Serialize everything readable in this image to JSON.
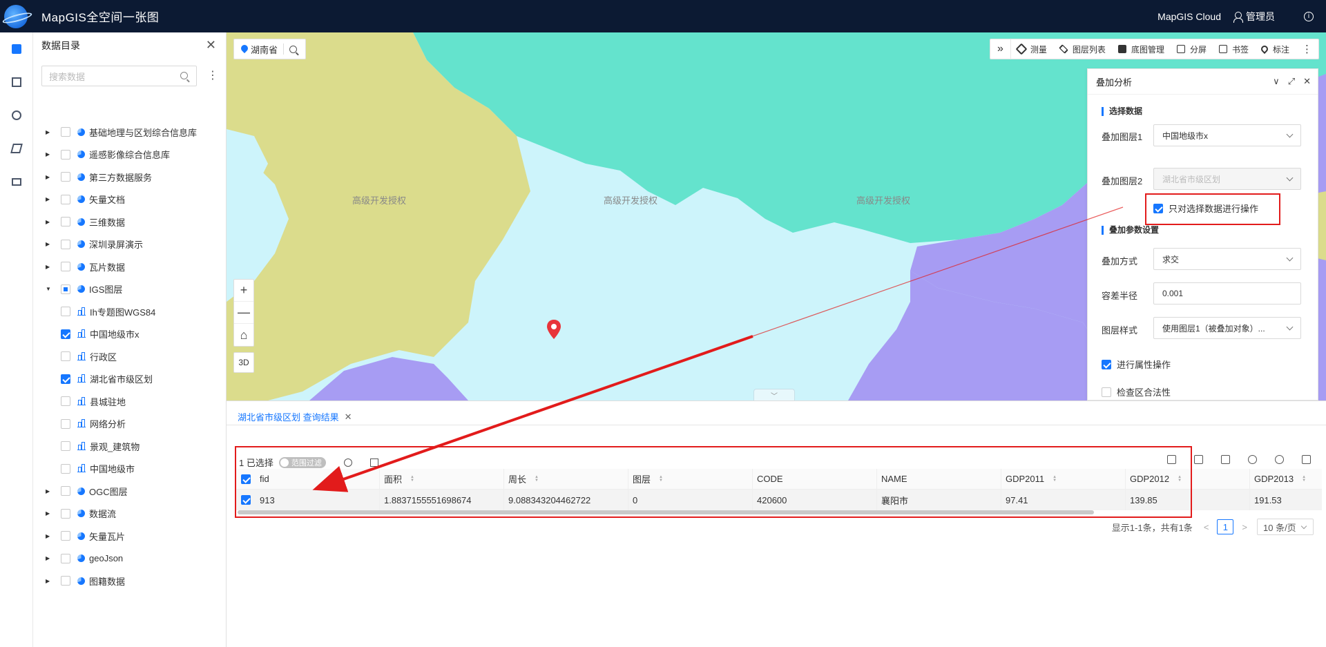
{
  "header": {
    "app_title": "MapGIS全空间一张图",
    "cloud": "MapGIS Cloud",
    "user": "管理员",
    "info": "i"
  },
  "catalog": {
    "title": "数据目录",
    "close": "✕",
    "search_placeholder": "搜索数据",
    "items": [
      {
        "label": "基础地理与区划综合信息库"
      },
      {
        "label": "遥感影像综合信息库"
      },
      {
        "label": "第三方数据服务"
      },
      {
        "label": "矢量文档"
      },
      {
        "label": "三维数据"
      },
      {
        "label": "深圳录屏演示"
      },
      {
        "label": "瓦片数据"
      },
      {
        "label": "IGS图层"
      },
      {
        "label": "Ih专题图WGS84"
      },
      {
        "label": "中国地级市x"
      },
      {
        "label": "行政区"
      },
      {
        "label": "湖北省市级区划"
      },
      {
        "label": "县城驻地"
      },
      {
        "label": "网络分析"
      },
      {
        "label": "景观_建筑物"
      },
      {
        "label": "中国地级市"
      },
      {
        "label": "OGC图层"
      },
      {
        "label": "数据流"
      },
      {
        "label": "矢量瓦片"
      },
      {
        "label": "geoJson"
      },
      {
        "label": "图籍数据"
      }
    ]
  },
  "map": {
    "location": "湖南省",
    "watermarks": [
      "高级开发授权",
      "高级开发授权",
      "高级开发授权"
    ],
    "zoom_in": "+",
    "zoom_out": "—",
    "home": "⌂",
    "mode_3d": "3D",
    "collapse": "﹀",
    "toolbar": {
      "expand": "»",
      "measure": "测量",
      "layers": "图层列表",
      "basemap": "底图管理",
      "split": "分屏",
      "bookmark": "书签",
      "mark": "标注"
    },
    "colors": {
      "light_blue": "#cdf4fb",
      "teal": "#64e3cd",
      "khaki": "#dbdc8c",
      "purple": "#a79cf3",
      "marker": "#e8343a"
    }
  },
  "overlay": {
    "title": "叠加分析",
    "section_data": "选择数据",
    "layer1_label": "叠加图层1",
    "layer1_value": "中国地级市x",
    "layer2_label": "叠加图层2",
    "layer2_value": "湖北省市级区划",
    "only_selected": "只对选择数据进行操作",
    "section_params": "叠加参数设置",
    "method_label": "叠加方式",
    "method_value": "求交",
    "tolerance_label": "容差半径",
    "tolerance_value": "0.001",
    "style_label": "图层样式",
    "style_value": "使用图层1（被叠加对象）...",
    "attr_op": "进行属性操作",
    "check_valid": "检查区合法性"
  },
  "result": {
    "tab": "湖北省市级区划 查询结果",
    "tab_close": "✕",
    "selected": "1 已选择",
    "range_filter": "范围过滤",
    "columns": [
      "fid",
      "面积",
      "周长",
      "图层",
      "CODE",
      "NAME",
      "GDP2011",
      "GDP2012",
      "GDP2013"
    ],
    "row": [
      "913",
      "1.8837155551698674",
      "9.088343204462722",
      "0",
      "420600",
      "襄阳市",
      "97.41",
      "139.85",
      "191.53"
    ],
    "summary": "显示1-1条，共有1条",
    "page": "1",
    "page_size": "10 条/页",
    "prev": "<",
    "next": ">"
  },
  "annotation_color": "#e21b1b"
}
